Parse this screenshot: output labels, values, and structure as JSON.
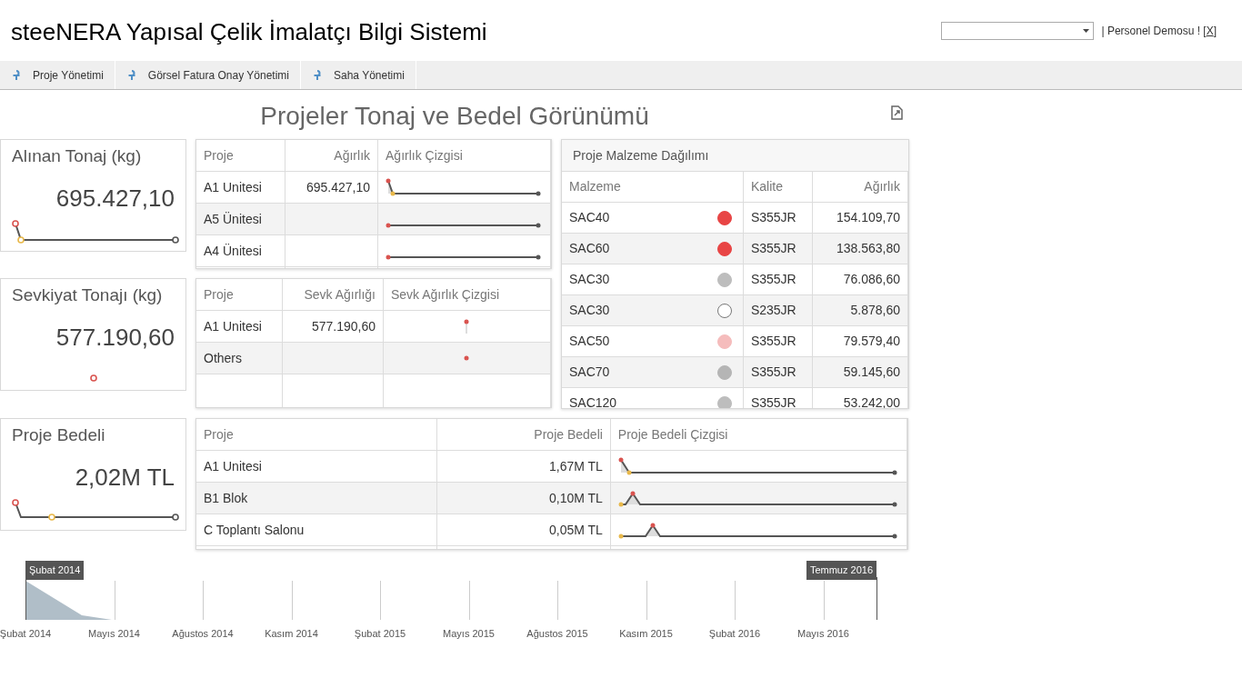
{
  "header": {
    "title": "steeNERA Yapısal Çelik İmalatçı Bilgi Sistemi",
    "user_prefix": "| Personel Demosu ! [",
    "logout_link": "X",
    "user_suffix": "]"
  },
  "nav": [
    {
      "label": "Proje Yönetimi",
      "selected": false
    },
    {
      "label": "Görsel Fatura Onay Yönetimi",
      "selected": false
    },
    {
      "label": "Saha Yönetimi",
      "selected": false
    }
  ],
  "dashboard_title": "Projeler Tonaj ve Bedel Görünümü",
  "kpis": [
    {
      "title": "Alınan Tonaj (kg)",
      "value": "695.427,10"
    },
    {
      "title": "Sevkiyat Tonajı (kg)",
      "value": "577.190,60"
    },
    {
      "title": "Proje Bedeli",
      "value": "2,02M TL"
    }
  ],
  "tonnage_table": {
    "columns": [
      "Proje",
      "Ağırlık",
      "Ağırlık Çizgisi"
    ],
    "rows": [
      {
        "project": "A1 Unitesi",
        "value": "695.427,10"
      },
      {
        "project": "A5 Ünitesi",
        "value": ""
      },
      {
        "project": "A4 Ünitesi",
        "value": ""
      }
    ]
  },
  "shipment_table": {
    "columns": [
      "Proje",
      "Sevk Ağırlığı",
      "Sevk Ağırlık Çizgisi"
    ],
    "rows": [
      {
        "project": "A1 Unitesi",
        "value": "577.190,60"
      },
      {
        "project": "Others",
        "value": ""
      }
    ]
  },
  "cost_table": {
    "columns": [
      "Proje",
      "Proje Bedeli",
      "Proje Bedeli Çizgisi"
    ],
    "rows": [
      {
        "project": "A1 Unitesi",
        "value": "1,67M TL"
      },
      {
        "project": "B1 Blok",
        "value": "0,10M TL"
      },
      {
        "project": "C Toplantı Salonu",
        "value": "0,05M TL"
      }
    ]
  },
  "material_panel": {
    "title": "Proje Malzeme Dağılımı",
    "columns": [
      "Malzeme",
      "Kalite",
      "Ağırlık"
    ],
    "rows": [
      {
        "material": "SAC40",
        "color": "#e84545",
        "quality": "S355JR",
        "weight": "154.109,70"
      },
      {
        "material": "SAC60",
        "color": "#e84545",
        "quality": "S355JR",
        "weight": "138.563,80"
      },
      {
        "material": "SAC30",
        "color": "#bdbdbd",
        "quality": "S355JR",
        "weight": "76.086,60"
      },
      {
        "material": "SAC30",
        "color": "#ffffff",
        "quality": "S235JR",
        "weight": "5.878,60"
      },
      {
        "material": "SAC50",
        "color": "#f5bcbc",
        "quality": "S355JR",
        "weight": "79.579,40"
      },
      {
        "material": "SAC70",
        "color": "#b5b5b5",
        "quality": "S355JR",
        "weight": "59.145,60"
      },
      {
        "material": "SAC120",
        "color": "#bdbdbd",
        "quality": "S355JR",
        "weight": "53.242,00"
      }
    ]
  },
  "timeline": {
    "start_handle": "Şubat 2014",
    "end_handle": "Temmuz 2016",
    "labels": [
      "Şubat 2014",
      "Mayıs 2014",
      "Ağustos 2014",
      "Kasım 2014",
      "Şubat 2015",
      "Mayıs 2015",
      "Ağustos 2015",
      "Kasım 2015",
      "Şubat 2016",
      "Mayıs 2016"
    ]
  }
}
